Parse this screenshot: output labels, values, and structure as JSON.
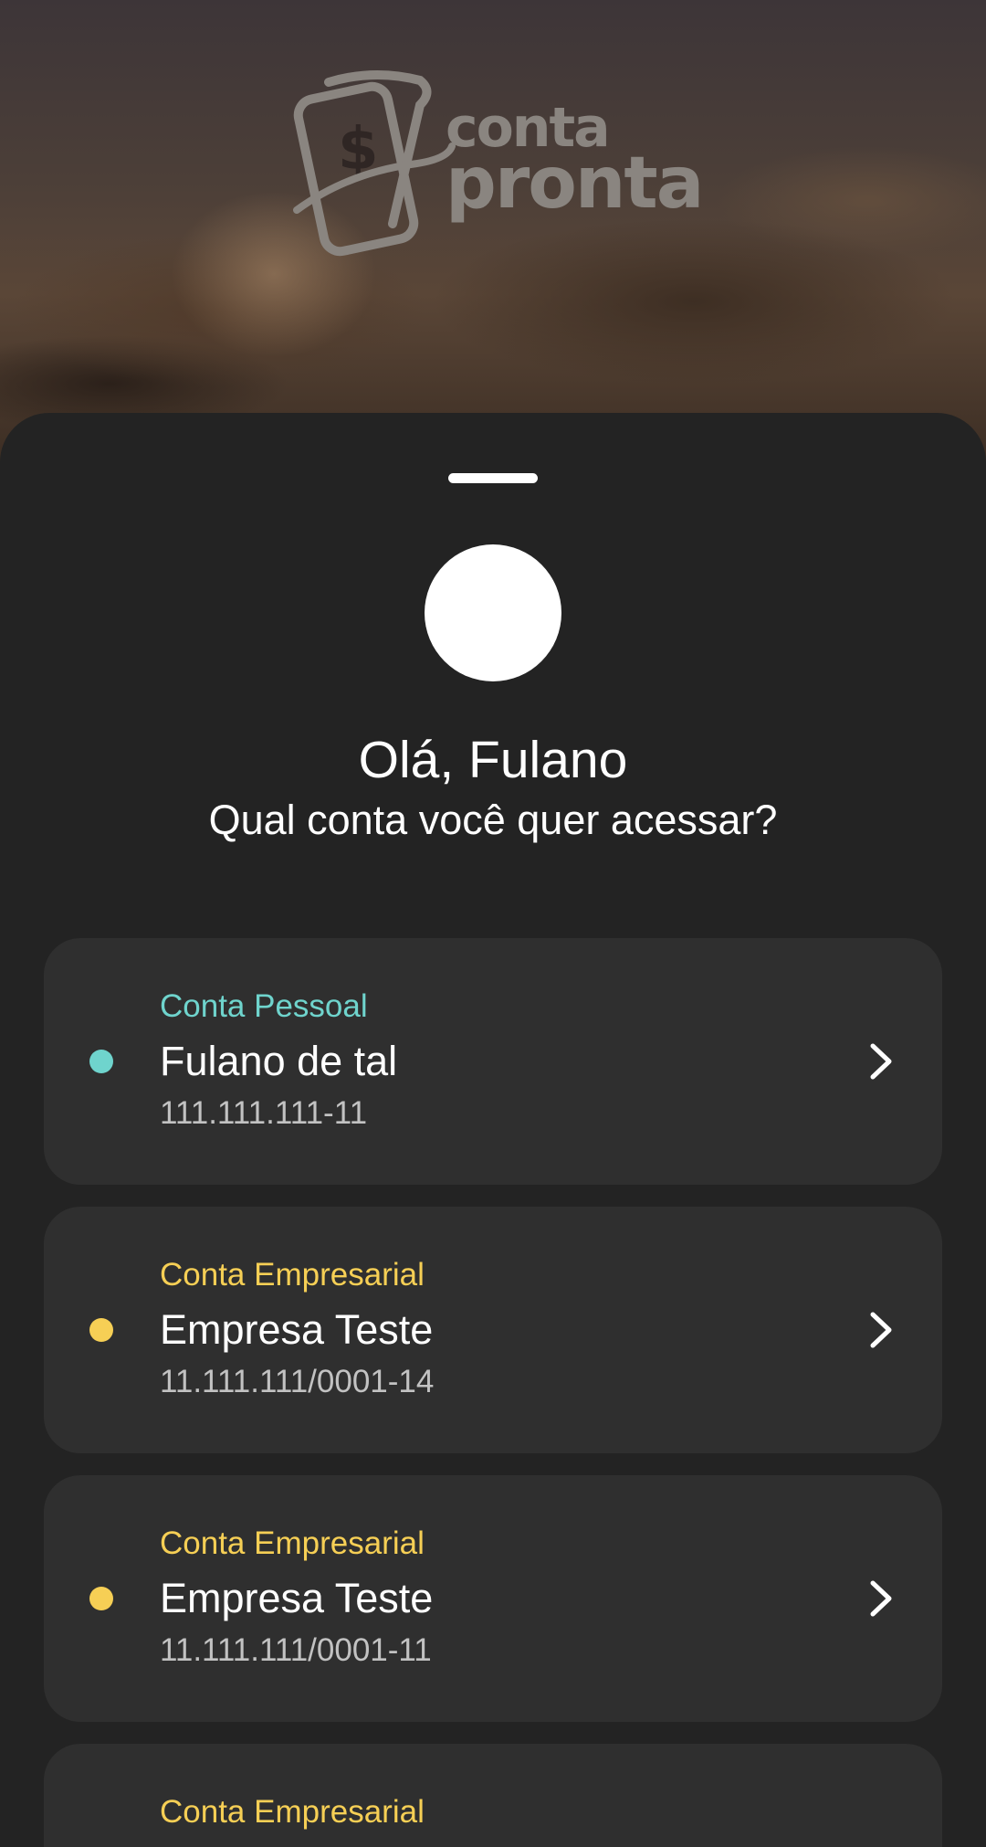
{
  "header": {
    "logo_line1": "conta",
    "logo_line2": "pronta"
  },
  "greeting": "Olá, Fulano",
  "question": "Qual conta você quer acessar?",
  "accounts": [
    {
      "type": "Conta Pessoal",
      "name": "Fulano de tal",
      "document": "111.111.111-11",
      "color": "#6fd4cd"
    },
    {
      "type": "Conta Empresarial",
      "name": "Empresa Teste",
      "document": "11.111.111/0001-14",
      "color": "#f6cf55"
    },
    {
      "type": "Conta Empresarial",
      "name": "Empresa Teste",
      "document": "11.111.111/0001-11",
      "color": "#f6cf55"
    },
    {
      "type": "Conta Empresarial",
      "color": "#f6cf55"
    }
  ],
  "icons": {
    "drag_handle": "drag-handle-icon",
    "avatar": "avatar",
    "chevron": "chevron-right-icon",
    "status_dot": "status-dot-icon"
  },
  "colors": {
    "background": "#232323",
    "card": "#2f2f2f",
    "personal_accent": "#6fd4cd",
    "business_accent": "#f6cf55"
  }
}
